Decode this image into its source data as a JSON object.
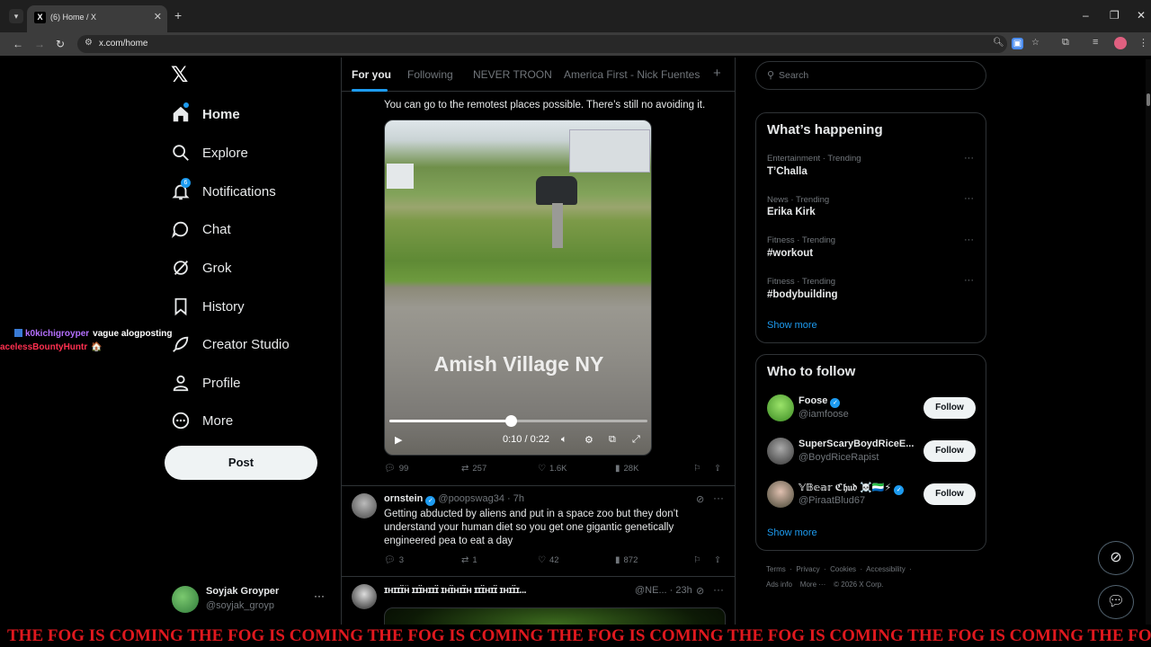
{
  "browser": {
    "tab_title": "(6) Home / X",
    "tab_favicon": "X",
    "url": "x.com/home"
  },
  "nav": {
    "logo": "𝕏",
    "items": [
      {
        "label": "Home",
        "icon": "home-icon"
      },
      {
        "label": "Explore",
        "icon": "search-icon"
      },
      {
        "label": "Notifications",
        "icon": "bell-icon",
        "badge": "6"
      },
      {
        "label": "Chat",
        "icon": "chat-icon"
      },
      {
        "label": "Grok",
        "icon": "grok-icon"
      },
      {
        "label": "History",
        "icon": "bookmark-icon"
      },
      {
        "label": "Creator Studio",
        "icon": "rocket-icon"
      },
      {
        "label": "Profile",
        "icon": "person-icon"
      },
      {
        "label": "More",
        "icon": "more-circle-icon"
      }
    ],
    "post_button": "Post",
    "account": {
      "name": "Soyjak Groyper",
      "handle": "@soyjak_groyp"
    }
  },
  "overlay_chat": {
    "line1_user": "k0kichigroyper",
    "line1_msg": "vague alogposting",
    "line2_user": "acelessBountyHuntr"
  },
  "feed": {
    "tabs": [
      "For you",
      "Following",
      "NEVER TROON",
      "America First - Nick Fuentes"
    ],
    "active_tab": "For you",
    "post1": {
      "text": "You can go to the remotest places possible. There’s still no avoiding it.",
      "video_caption": "Amish Village NY",
      "video_time": "0:10 / 0:22",
      "progress": 0.47,
      "replies": "99",
      "reposts": "257",
      "likes": "1.6K",
      "views": "28K"
    },
    "post2": {
      "name": "ornstein",
      "handle": "@poopswag34 · 7h",
      "text": "Getting abducted by aliens and put in a space zoo but they don’t understand your human diet so you get one gigantic genetically engineered pea to eat a day",
      "replies": "3",
      "reposts": "1",
      "likes": "42",
      "views": "872"
    },
    "post3": {
      "name": "ɪʜɪɪɪ̈ʜ̈ ɪɪɪ̈ʜɪɪɪ̈ ɪʜɪ̈ʜɪɪ̈ʜ ɪɪɪ̈ʜɪɪ̈ ɪʜɪɪ̈ɪ...",
      "handle": "@NE... · 23h"
    }
  },
  "right": {
    "search_placeholder": "Search",
    "happening_title": "What’s happening",
    "trends": [
      {
        "meta": "Entertainment · Trending",
        "name": "T’Challa"
      },
      {
        "meta": "News · Trending",
        "name": "Erika Kirk"
      },
      {
        "meta": "Fitness · Trending",
        "name": "#workout"
      },
      {
        "meta": "Fitness · Trending",
        "name": "#bodybuilding"
      }
    ],
    "show_more": "Show more",
    "wtf_title": "Who to follow",
    "who_to_follow": [
      {
        "name": "Foose",
        "handle": "@iamfoose",
        "verified": true
      },
      {
        "name": "SuperScaryBoydRiceE...",
        "handle": "@BoydRiceRapist",
        "verified": false
      },
      {
        "name": "𝕐𝔹𝕖𝕒𝕣 ℭ𝔥𝔲𝔡 ☠️🇸🇱⚡",
        "handle": "@PiraatBlud67",
        "verified": true
      }
    ],
    "follow_label": "Follow",
    "footer_line1": [
      "Terms",
      "Privacy",
      "Cookies",
      "Accessibility"
    ],
    "footer_line2": [
      "Ads info",
      "More ···",
      "© 2026 X Corp."
    ]
  },
  "ticker": "THE FOG IS COMING THE FOG IS COMING THE FOG IS COMING THE FOG IS COMING THE FOG IS COMING THE FOG IS COMING THE FOG IS COMING"
}
